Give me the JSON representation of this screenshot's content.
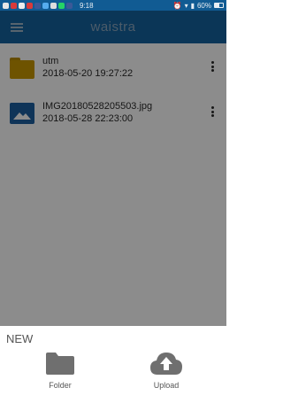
{
  "status_bar": {
    "time": "9:18",
    "battery": "60%",
    "battery_level": 0.6
  },
  "app": {
    "title": "waistra"
  },
  "files": [
    {
      "name": "utm",
      "date": "2018-05-20 19:27:22",
      "type": "folder"
    },
    {
      "name": "IMG20180528205503.jpg",
      "date": "2018-05-28 22:23:00",
      "type": "image"
    }
  ],
  "sheet": {
    "title": "NEW",
    "actions": [
      {
        "label": "Folder",
        "icon": "folder-icon"
      },
      {
        "label": "Upload",
        "icon": "cloud-upload-icon"
      }
    ]
  },
  "colors": {
    "header": "#14639f",
    "status_bar": "#115b93",
    "folder": "#c99700",
    "image_icon": "#1d5fa1"
  }
}
